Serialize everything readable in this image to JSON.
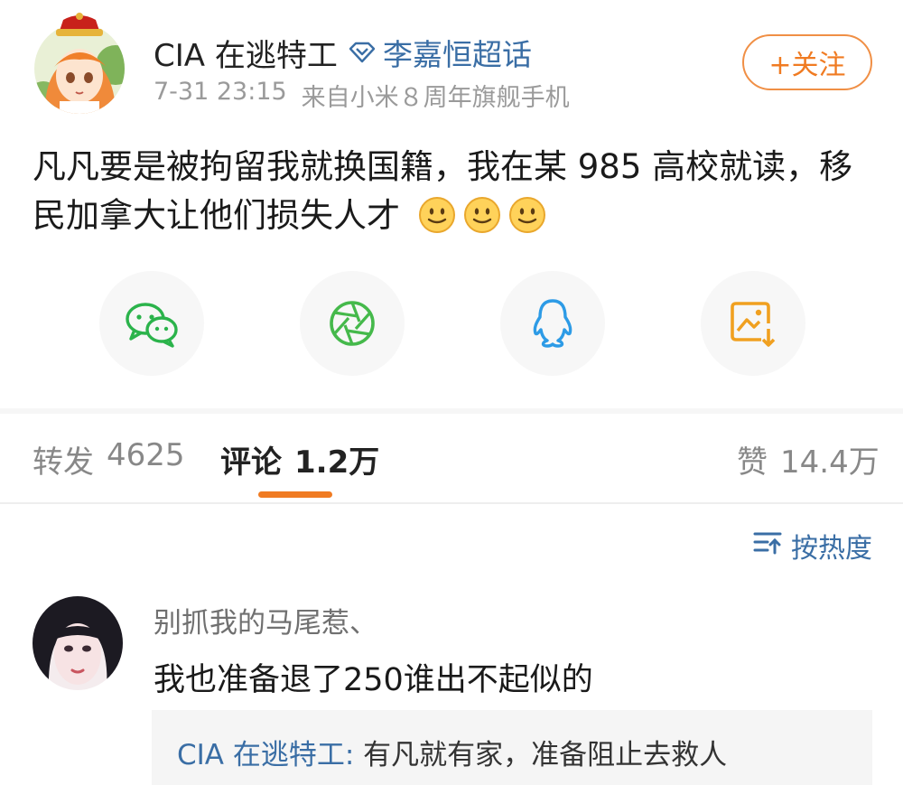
{
  "post": {
    "author": "CIA 在逃特工",
    "supertopic": {
      "icon": "diamond-icon",
      "label": "李嘉恒超话",
      "color": "#3a6ea5"
    },
    "timestamp": "7-31 23:15",
    "source": "来自小米８周年旗舰手机",
    "follow_label": "+关注",
    "text": "凡凡要是被拘留我就换国籍，我在某 985 高校就读，移民加拿大让他们损失人才",
    "emojis": [
      "smile-emoji",
      "smile-emoji",
      "smile-emoji"
    ]
  },
  "share": [
    {
      "name": "wechat",
      "icon": "wechat-icon",
      "color": "#2bb34b"
    },
    {
      "name": "moments",
      "icon": "moments-shutter-icon",
      "color": "#45b94b"
    },
    {
      "name": "qq",
      "icon": "qq-penguin-icon",
      "color": "#2d9be6"
    },
    {
      "name": "save-image",
      "icon": "save-image-icon",
      "color": "#f0a020"
    }
  ],
  "tabs": {
    "repost": {
      "label": "转发",
      "count": "4625"
    },
    "comment": {
      "label": "评论",
      "count": "1.2万"
    },
    "like": {
      "label": "赞",
      "count": "14.4万"
    }
  },
  "accent_color": "#f07b22",
  "sort": {
    "icon": "sort-icon",
    "label": "按热度"
  },
  "comment": {
    "user": "别抓我的马尾惹、",
    "text": "我也准备退了250谁出不起似的",
    "reply": {
      "author": "CIA 在逃特工:",
      "text": "有凡就有家，准备阻止去救人"
    }
  }
}
